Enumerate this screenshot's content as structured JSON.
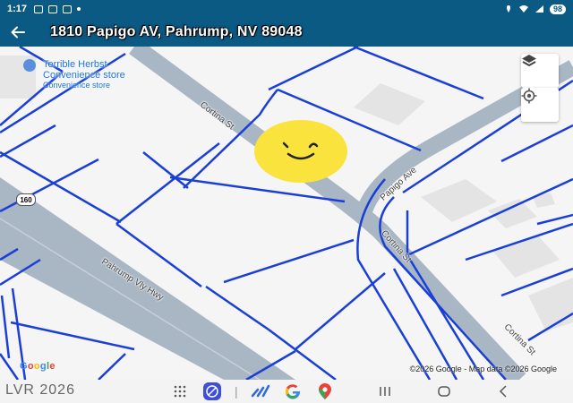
{
  "status_bar": {
    "time": "1:17",
    "battery": "98"
  },
  "app_bar": {
    "address": "1810 Papigo AV, Pahrump, NV  89048",
    "back_icon": "arrow-left-icon"
  },
  "map": {
    "poi": {
      "name_line1": "Terrible Herbst",
      "name_line2": "Convenience store",
      "category": "Convenience store",
      "icon": "shopping-bag-icon"
    },
    "streets": {
      "cortina_upper": "Cortina St",
      "cortina_lower": "Cortina St",
      "papigo": "Papigo Ave",
      "highway": "Pahrump Vly Hwy",
      "highway_shield": "160"
    },
    "controls": {
      "layers_icon": "layers-icon",
      "location_icon": "my-location-icon"
    },
    "logo": {
      "letters": [
        "G",
        "o",
        "o",
        "g",
        "l",
        "e"
      ],
      "colors": [
        "#4285f4",
        "#ea4335",
        "#fbbc05",
        "#4285f4",
        "#34a853",
        "#ea4335"
      ]
    },
    "attribution": "©2026 Google - Map data ©2026 Google",
    "colors": {
      "parcel_line": "#1a3fd6",
      "road": "#a9b6c4",
      "background": "#f5f5f5"
    }
  },
  "nav_bar": {
    "watermark": "LVR 2026",
    "dock_icons": [
      "apps-grid-icon",
      "browser-icon",
      "analytics-icon",
      "google-icon",
      "maps-icon"
    ],
    "system_icons": [
      "recents-icon",
      "home-icon",
      "back-nav-icon"
    ]
  }
}
